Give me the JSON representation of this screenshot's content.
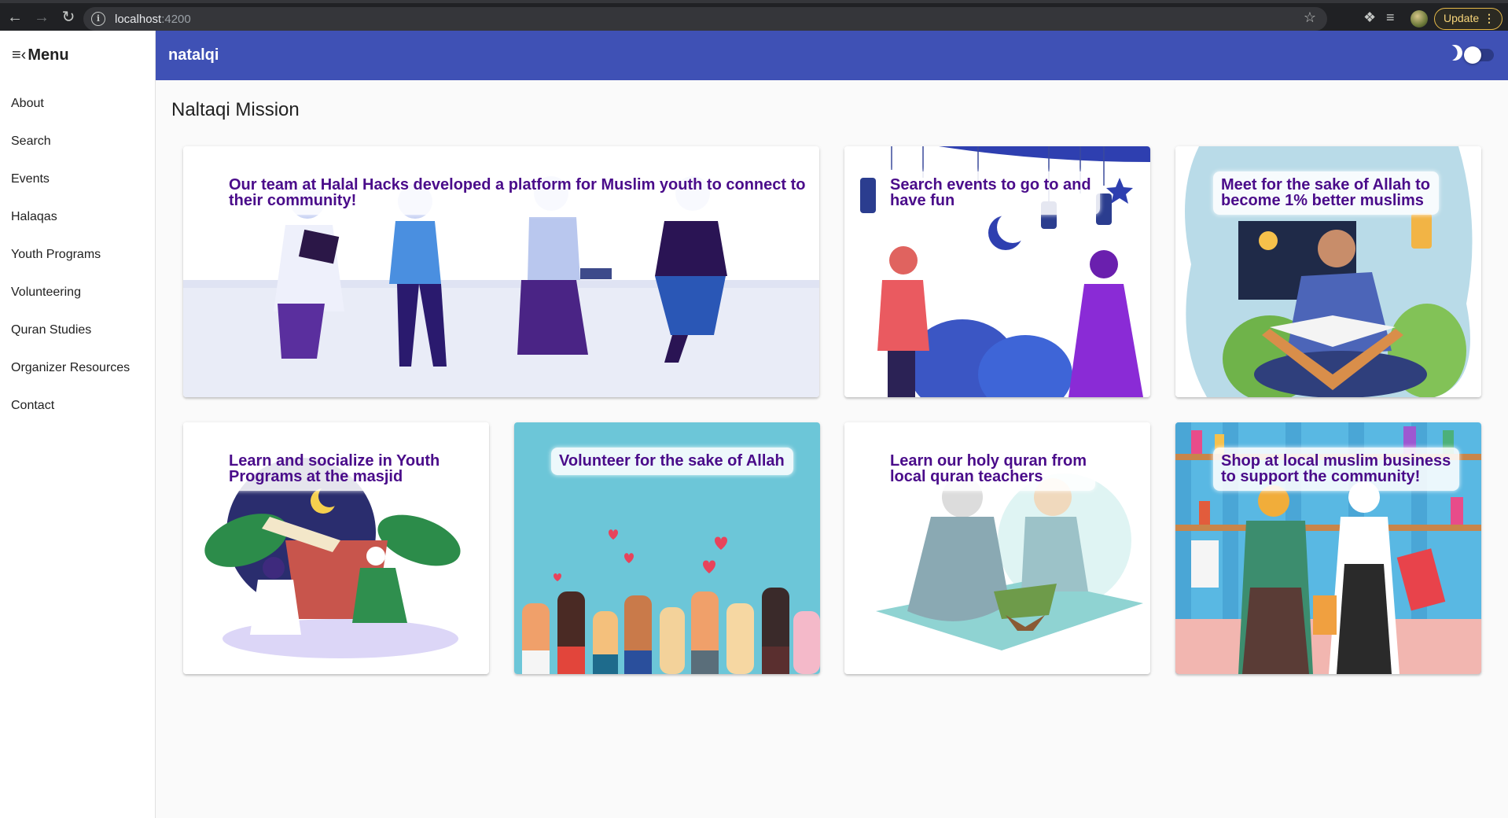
{
  "browser": {
    "url_host": "localhost",
    "url_port": ":4200",
    "update_label": "Update"
  },
  "sidebar": {
    "title": "Menu",
    "items": [
      {
        "label": "About"
      },
      {
        "label": "Search"
      },
      {
        "label": "Events"
      },
      {
        "label": "Halaqas"
      },
      {
        "label": "Youth Programs"
      },
      {
        "label": "Volunteering"
      },
      {
        "label": "Quran Studies"
      },
      {
        "label": "Organizer Resources"
      },
      {
        "label": "Contact"
      }
    ]
  },
  "header": {
    "app_title": "natalqi"
  },
  "main": {
    "page_title": "Naltaqi Mission",
    "cards": [
      {
        "caption_lines": [
          "Our team at Halal Hacks developed a platform for Muslim youth to connect to",
          "their community!"
        ]
      },
      {
        "caption_lines": [
          "Search events to go to and",
          "have fun"
        ]
      },
      {
        "caption_lines": [
          "Meet for the sake of Allah to",
          "become 1% better muslims"
        ]
      },
      {
        "caption_lines": [
          "Learn and socialize in Youth",
          "Programs at the masjid"
        ]
      },
      {
        "caption_lines": [
          "Volunteer for the sake of Allah"
        ]
      },
      {
        "caption_lines": [
          "Learn our holy quran from",
          "local quran teachers"
        ]
      },
      {
        "caption_lines": [
          "Shop at local muslim business",
          "to support the community!"
        ]
      }
    ]
  },
  "colors": {
    "app_bar": "#3f51b5",
    "caption_text": "#4a0c8a",
    "update_accent": "#e5b94a"
  }
}
